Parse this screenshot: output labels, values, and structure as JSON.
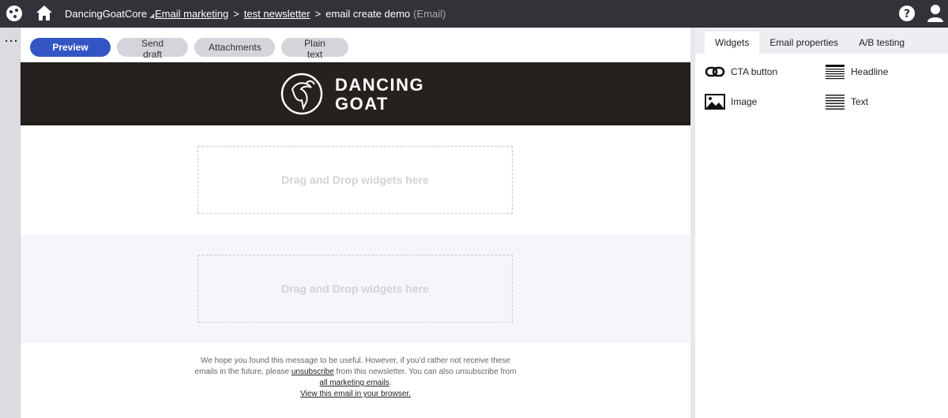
{
  "topbar": {
    "site_name": "DancingGoatCore",
    "site_caret": "◢",
    "breadcrumbs": [
      "Email marketing",
      "test newsletter"
    ],
    "current_page": "email create demo",
    "current_type": "(Email)",
    "separator": ">"
  },
  "sidebar": {
    "more_label": "···"
  },
  "toolbar": {
    "preview": "Preview",
    "send_draft": "Send draft",
    "attachments": "Attachments",
    "plain_text": "Plain text"
  },
  "email": {
    "logo_line1": "DANCING",
    "logo_line2": "GOAT",
    "zones": [
      {
        "placeholder": "Drag and Drop widgets here"
      },
      {
        "placeholder": "Drag and Drop widgets here"
      }
    ],
    "footer": {
      "text1": "We hope you found this message to be useful. However, if you'd rather not receive these",
      "text2_before": "emails in the future, please ",
      "unsubscribe": "unsubscribe",
      "text2_after": " from this newsletter. You can also unsubscribe from",
      "all_marketing": "all marketing emails",
      "text3_after": ".",
      "view_browser": "View this email in your browser."
    }
  },
  "panel": {
    "tabs": [
      "Widgets",
      "Email properties",
      "A/B testing"
    ],
    "active_tab": "Widgets",
    "widgets": [
      {
        "label": "CTA button",
        "icon": "link-icon"
      },
      {
        "label": "Headline",
        "icon": "headline-icon"
      },
      {
        "label": "Image",
        "icon": "image-icon"
      },
      {
        "label": "Text",
        "icon": "text-icon"
      }
    ]
  },
  "colors": {
    "topbar": "#323238",
    "primary": "#3355c4",
    "header_bg": "#26211e"
  }
}
